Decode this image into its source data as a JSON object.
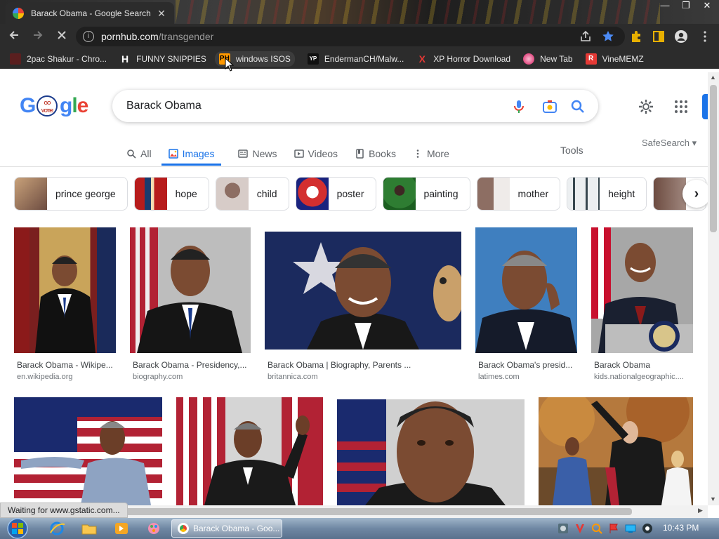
{
  "browser": {
    "tab_title": "Barack Obama - Google Search",
    "close_glyph": "✕",
    "url_host": "pornhub.com",
    "url_path": "/transgender",
    "window_controls": [
      "—",
      "❐",
      "✕"
    ]
  },
  "bookmarks": [
    {
      "label": "2pac Shakur - Chro...",
      "icon": "2pac-favicon",
      "color": "#c0392b"
    },
    {
      "label": "FUNNY SNIPPIES",
      "icon": "h-favicon",
      "glyph": "H",
      "color": "#ffffff"
    },
    {
      "label": "windows ISOS",
      "icon": "ph-favicon",
      "glyph": "PH",
      "color": "#ff9900"
    },
    {
      "label": "EndermanCH/Malw...",
      "icon": "yp-favicon",
      "glyph": "YP",
      "color": "#ffffff"
    },
    {
      "label": "XP Horror Download",
      "icon": "x-favicon",
      "glyph": "X",
      "color": "#e53935"
    },
    {
      "label": "New Tab",
      "icon": "new-tab-favicon",
      "color": "#d81b60"
    },
    {
      "label": "VineMEMZ",
      "icon": "r-favicon",
      "glyph": "R",
      "color": "#e53935"
    }
  ],
  "google": {
    "logo_letters": [
      "G",
      "o",
      "g",
      "l",
      "e"
    ],
    "badge_text": "GO VOTE!",
    "query": "Barack Obama",
    "tabs": [
      {
        "label": "All",
        "icon": "search-icon"
      },
      {
        "label": "Images",
        "icon": "image-icon"
      },
      {
        "label": "News",
        "icon": "news-icon"
      },
      {
        "label": "Videos",
        "icon": "video-icon"
      },
      {
        "label": "Books",
        "icon": "book-icon"
      },
      {
        "label": "More",
        "icon": "more-vert-icon"
      }
    ],
    "tools_label": "Tools",
    "safesearch_label": "SafeSearch"
  },
  "chips": [
    {
      "label": "prince george",
      "color": "#8d6e63"
    },
    {
      "label": "hope",
      "color": "#b71c1c"
    },
    {
      "label": "child",
      "color": "#a1887f"
    },
    {
      "label": "poster",
      "color": "#d32f2f"
    },
    {
      "label": "painting",
      "color": "#2e7d32"
    },
    {
      "label": "mother",
      "color": "#5d4037"
    },
    {
      "label": "height",
      "color": "#cfd8dc"
    },
    {
      "label": "",
      "color": "#6d4c41"
    }
  ],
  "results": [
    {
      "caption": "Barack Obama - Wikipe...",
      "source": "en.wikipedia.org"
    },
    {
      "caption": "Barack Obama - Presidency,...",
      "source": "biography.com"
    },
    {
      "caption": "Barack Obama | Biography, Parents ...",
      "source": "britannica.com"
    },
    {
      "caption": "Barack Obama's presid...",
      "source": "latimes.com"
    },
    {
      "caption": "Barack Obama",
      "source": "kids.nationalgeographic...."
    }
  ],
  "status_text": "Waiting for www.gstatic.com...",
  "taskbar": {
    "task_label": "Barack Obama - Goo...",
    "clock": "10:43 PM"
  }
}
